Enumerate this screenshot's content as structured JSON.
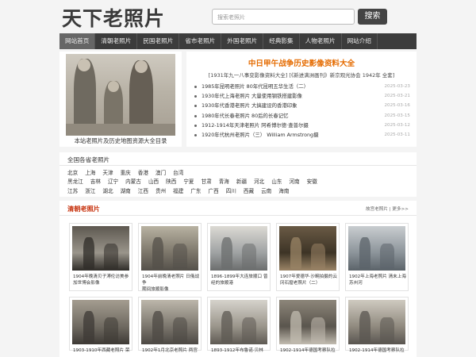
{
  "header": {
    "logo": "天下老照片",
    "search_placeholder": "搜索老照片",
    "search_button": "搜索"
  },
  "nav": [
    {
      "label": "网站首页",
      "active": true
    },
    {
      "label": "清朝老照片"
    },
    {
      "label": "民国老照片"
    },
    {
      "label": "省市老照片"
    },
    {
      "label": "外国老照片"
    },
    {
      "label": "经典影集"
    },
    {
      "label": "人物老照片"
    },
    {
      "label": "网站介绍"
    }
  ],
  "feature": {
    "caption": "本站老照片及历史地图资源大全目录"
  },
  "topnews": {
    "title": "中日甲午战争历史影像资料大全",
    "subtitle": "[1931年九一八事变影像资料大全]  [《新进满洲画刊》新京观光协会 1942年 全套]",
    "items": [
      {
        "title": "1985年昆明老照片 80年代昆明五华生活（二）",
        "date": "2025-03-23"
      },
      {
        "title": "1930年代上海老照片 大量使用钢铁搭建影像",
        "date": "2025-03-21"
      },
      {
        "title": "1930年代香港老照片 大搞建设的香港印象",
        "date": "2025-03-16"
      },
      {
        "title": "1980年代长春老照片 80后的长春记忆",
        "date": "2025-03-15"
      },
      {
        "title": "1912-1914年天津老照片 阿希博尔德·查普尔摄",
        "date": "2025-03-12"
      },
      {
        "title": "1920年代杭州老照片（三） William Armstrong摄",
        "date": "2025-03-11"
      }
    ]
  },
  "regions": {
    "title": "全国各省老照片",
    "rows": [
      [
        "北京",
        "上海",
        "天津",
        "重庆",
        "香港",
        "澳门",
        "台湾"
      ],
      [
        "黑龙江",
        "吉林",
        "辽宁",
        "内蒙古",
        "山西",
        "陕西",
        "宁夏",
        "甘肃",
        "青海",
        "新疆",
        "河北",
        "山东",
        "河南",
        "安徽"
      ],
      [
        "江苏",
        "浙江",
        "湖北",
        "湖南",
        "江西",
        "贵州",
        "福建",
        "广东",
        "广西",
        "四川",
        "西藏",
        "云南",
        "海南"
      ]
    ]
  },
  "qing": {
    "title": "清朝老照片",
    "more": "故宫老照片 | 更多>>",
    "cards": [
      {
        "lines": [
          "1904年晚清贝子溥伦访美参",
          "加世博会影像"
        ],
        "theme": "portrait"
      },
      {
        "lines": [
          "1904年前晚清老照片 日俄战争",
          "期间旅顺影像"
        ],
        "theme": "street"
      },
      {
        "lines": [
          "1896-1899年大连旅顺口 曾",
          "经的旅顺港"
        ],
        "theme": "harbor"
      },
      {
        "lines": [
          "1907年爱德华·沙畹拍摄的云",
          "冈石窟老照片（二）"
        ],
        "theme": "statue"
      },
      {
        "lines": [
          "1902年上海老照片 清末上海",
          "苏州河"
        ],
        "theme": "river"
      },
      {
        "lines": [
          "1903-1910年西藏老照片 荣"
        ],
        "theme": "group"
      },
      {
        "lines": [
          "1902年1月北京老照片 两宫"
        ],
        "theme": "crowd"
      },
      {
        "lines": [
          "1893-1912年布鲁诺·贝林"
        ],
        "theme": "gate"
      },
      {
        "lines": [
          "1902-1914年德国考察队拉"
        ],
        "theme": "people"
      },
      {
        "lines": [
          "1902-1914年德国考察队拉"
        ],
        "theme": "wall"
      }
    ]
  }
}
